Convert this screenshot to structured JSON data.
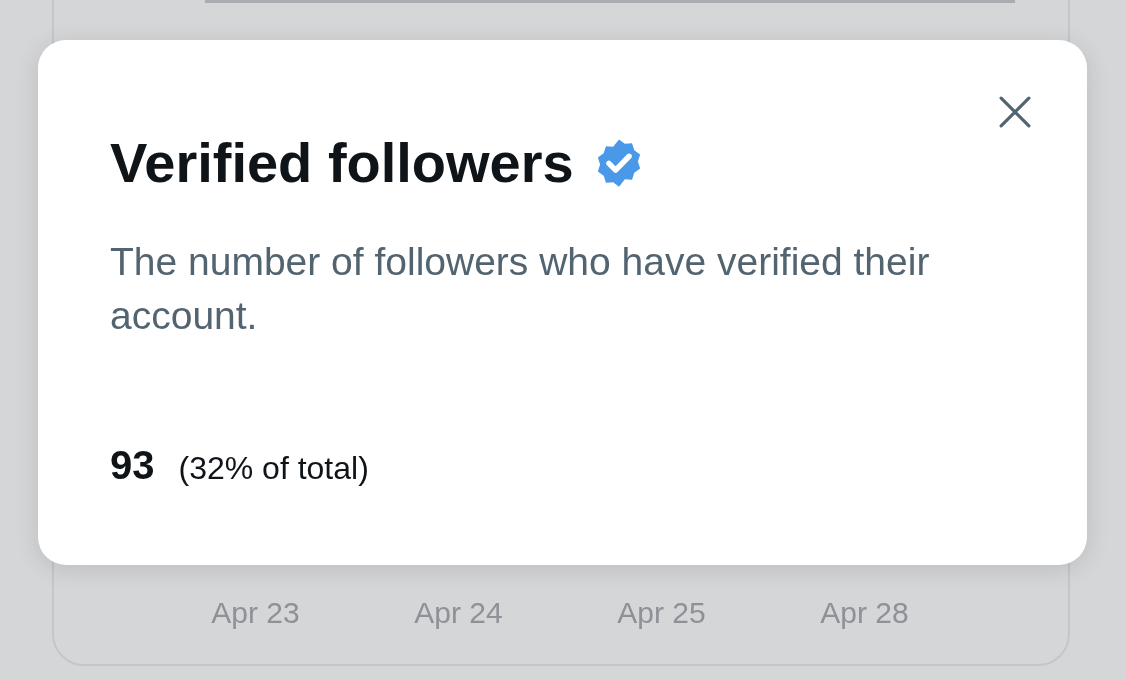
{
  "chart": {
    "x_labels": [
      "Apr 23",
      "Apr 24",
      "Apr 25",
      "Apr 28"
    ]
  },
  "dialog": {
    "title": "Verified followers",
    "verified": true,
    "description": "The number of followers who have verified their account.",
    "count": "93",
    "share": "(32% of total)"
  }
}
